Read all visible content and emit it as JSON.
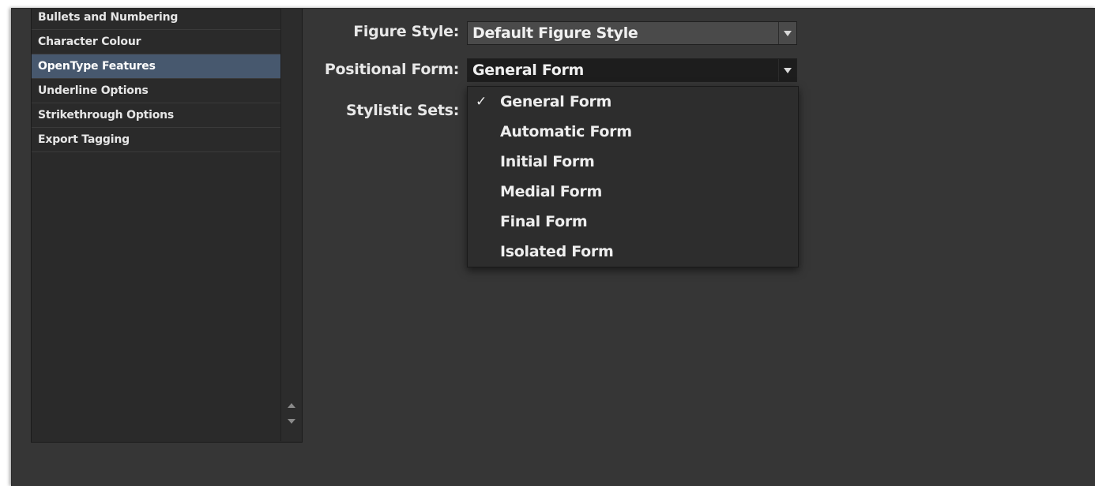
{
  "categories": [
    {
      "label": "Bullets and Numbering",
      "selected": false
    },
    {
      "label": "Character Colour",
      "selected": false
    },
    {
      "label": "OpenType Features",
      "selected": true
    },
    {
      "label": "Underline Options",
      "selected": false
    },
    {
      "label": "Strikethrough Options",
      "selected": false
    },
    {
      "label": "Export Tagging",
      "selected": false
    }
  ],
  "form": {
    "figure_style": {
      "label": "Figure Style:",
      "value": "Default Figure Style"
    },
    "positional_form": {
      "label": "Positional Form:",
      "value": "General Form"
    },
    "stylistic_sets": {
      "label": "Stylistic Sets:"
    }
  },
  "dropdown": {
    "check_glyph": "✓",
    "options": [
      {
        "label": "General Form",
        "checked": true
      },
      {
        "label": "Automatic Form",
        "checked": false
      },
      {
        "label": "Initial Form",
        "checked": false
      },
      {
        "label": "Medial Form",
        "checked": false
      },
      {
        "label": "Final Form",
        "checked": false
      },
      {
        "label": "Isolated Form",
        "checked": false
      }
    ]
  },
  "colors": {
    "panel_bg": "#363636",
    "list_bg": "#2a2a2a",
    "selected_bg": "#47586e"
  }
}
